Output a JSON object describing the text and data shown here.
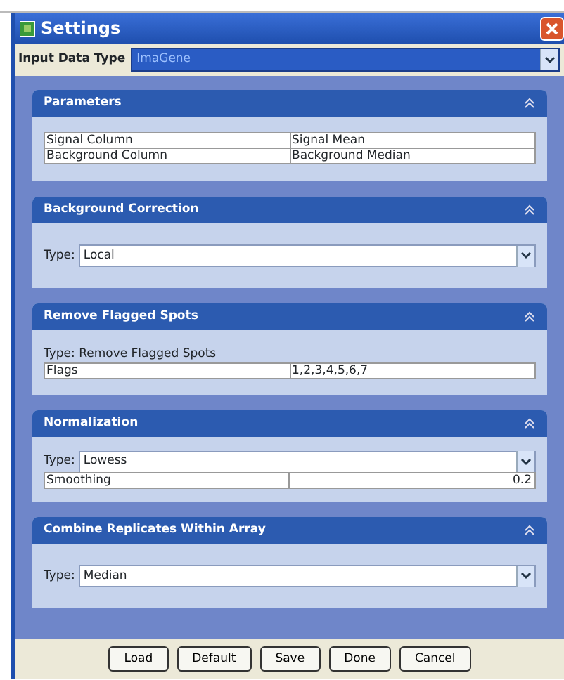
{
  "window": {
    "title": "Settings"
  },
  "input_data_type": {
    "label": "Input Data Type",
    "value": "ImaGene"
  },
  "sections": [
    {
      "title": "Parameters",
      "expanded": true,
      "items": [
        {
          "kind": "pair",
          "name": "Signal Column",
          "value": "Signal Mean"
        },
        {
          "kind": "pair",
          "name": "Background Column",
          "value": "Background Median"
        }
      ]
    },
    {
      "title": "Background Correction",
      "expanded": true,
      "items": [
        {
          "kind": "select",
          "label": "Type:",
          "value": "Local"
        }
      ]
    },
    {
      "title": "Remove Flagged Spots",
      "expanded": true,
      "items": [
        {
          "kind": "text",
          "text": "Type: Remove Flagged Spots"
        },
        {
          "kind": "pair",
          "name": "Flags",
          "value": "1,2,3,4,5,6,7"
        }
      ]
    },
    {
      "title": "Normalization",
      "expanded": true,
      "items": [
        {
          "kind": "select",
          "label": "Type:",
          "value": "Lowess"
        },
        {
          "kind": "number",
          "name": "Smoothing",
          "value": "0.2"
        }
      ]
    },
    {
      "title": "Combine Replicates Within Array",
      "expanded": true,
      "items": [
        {
          "kind": "select",
          "label": "Type:",
          "value": "Median"
        }
      ]
    }
  ],
  "buttons": [
    "Load",
    "Default",
    "Save",
    "Done",
    "Cancel"
  ]
}
